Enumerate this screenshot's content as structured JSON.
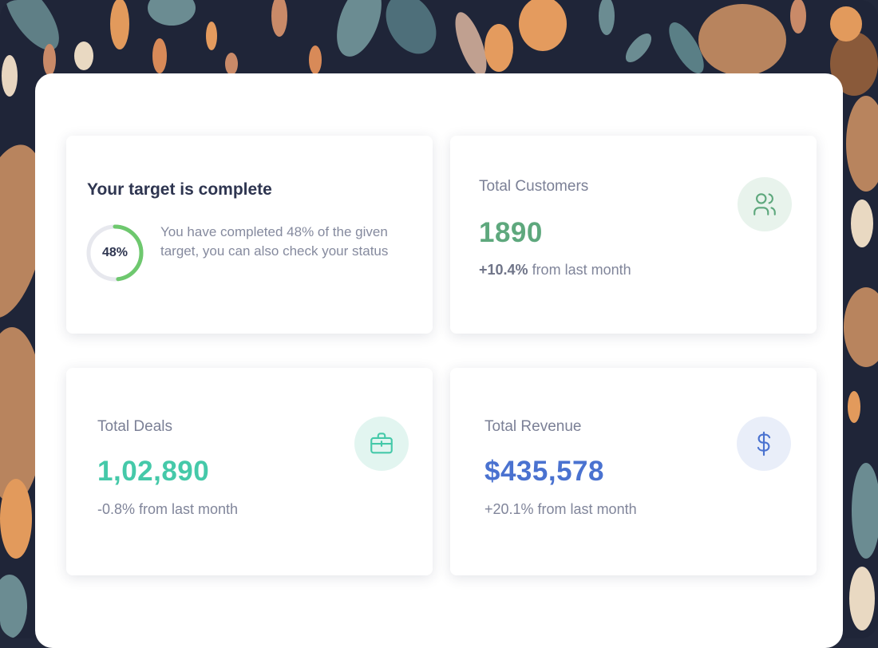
{
  "colors": {
    "background": "#22283b",
    "customers_accent": "#5ea87d",
    "deals_accent": "#45c9a9",
    "revenue_accent": "#4a72d0",
    "progress_accent": "#6ec86e"
  },
  "target_card": {
    "title": "Your target is complete",
    "progress_label": "48%",
    "progress_fraction": 0.48,
    "description": "You have completed 48% of the given target, you can also check your status"
  },
  "customers_card": {
    "title": "Total Customers",
    "value": "1890",
    "change": "+10.4%",
    "change_suffix": " from last month",
    "icon": "users-icon"
  },
  "deals_card": {
    "title": "Total Deals",
    "value": "1,02,890",
    "change": "-0.8% from last month",
    "icon": "briefcase-icon"
  },
  "revenue_card": {
    "title": "Total Revenue",
    "value": "$435,578",
    "change": "+20.1% from last month",
    "icon": "dollar-icon"
  }
}
